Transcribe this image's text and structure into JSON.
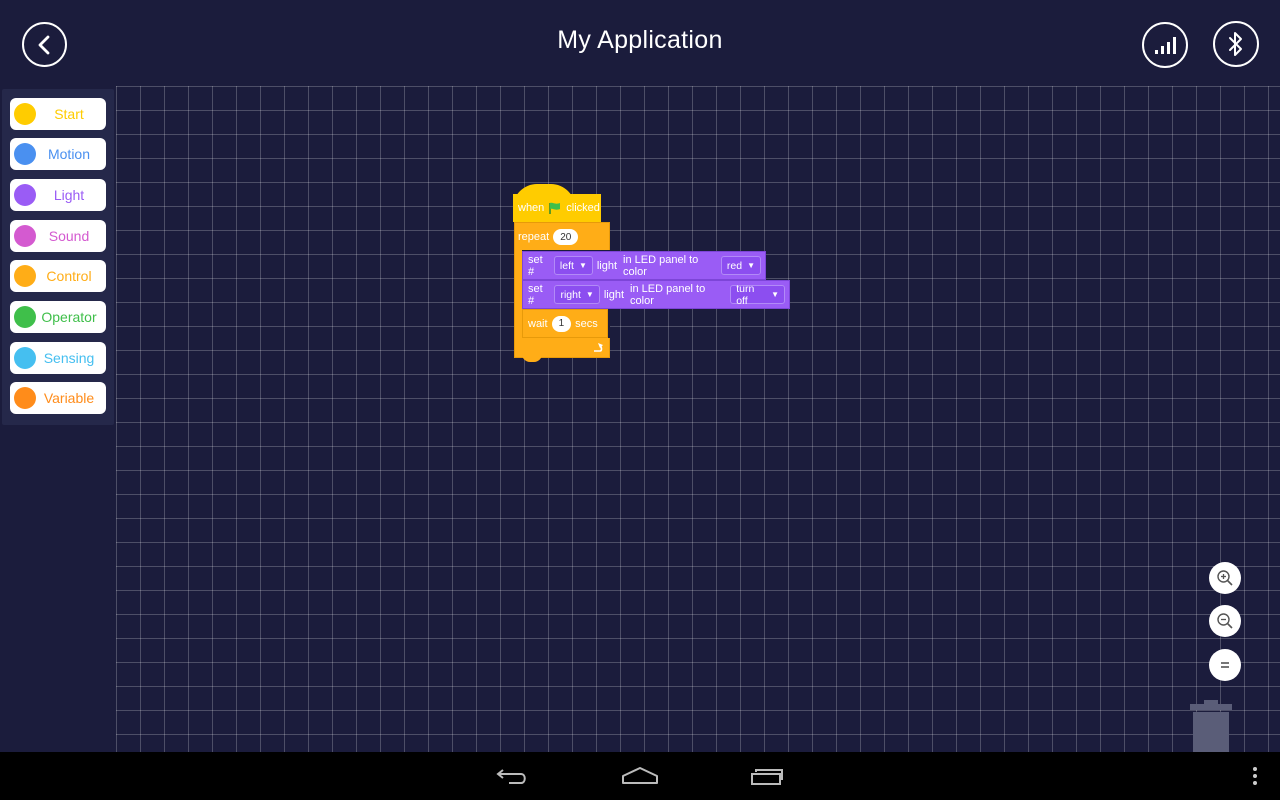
{
  "header": {
    "title": "My Application"
  },
  "categories": [
    {
      "label": "Start",
      "color": "#ffcc00"
    },
    {
      "label": "Motion",
      "color": "#4a90f0"
    },
    {
      "label": "Light",
      "color": "#9a5cf5"
    },
    {
      "label": "Sound",
      "color": "#d45ad0"
    },
    {
      "label": "Control",
      "color": "#ffad17"
    },
    {
      "label": "Operator",
      "color": "#3fbf4a"
    },
    {
      "label": "Sensing",
      "color": "#45bff0"
    },
    {
      "label": "Variable",
      "color": "#ff8c1a"
    }
  ],
  "script": {
    "hat": {
      "when": "when",
      "clicked": "clicked"
    },
    "repeat": {
      "label": "repeat",
      "count": "20"
    },
    "set1": {
      "set": "set #",
      "side": "left",
      "light": "light",
      "text": "in LED panel to color",
      "color": "red"
    },
    "set2": {
      "set": "set #",
      "side": "right",
      "light": "light",
      "text": "in LED panel to color",
      "color": "turn off"
    },
    "wait": {
      "label": "wait",
      "value": "1",
      "unit": "secs"
    }
  },
  "colors": {
    "background": "#1b1c3c",
    "control": "#ffad17",
    "light": "#9a5cf5",
    "start": "#ffcc00"
  },
  "icons": [
    "back-arrow-icon",
    "signal-strength-icon",
    "bluetooth-icon",
    "green-flag-icon",
    "loop-arrow-icon",
    "zoom-in-icon",
    "zoom-out-icon",
    "zoom-reset-icon",
    "trash-icon",
    "nav-back-icon",
    "nav-home-icon",
    "nav-recents-icon",
    "overflow-menu-icon"
  ]
}
